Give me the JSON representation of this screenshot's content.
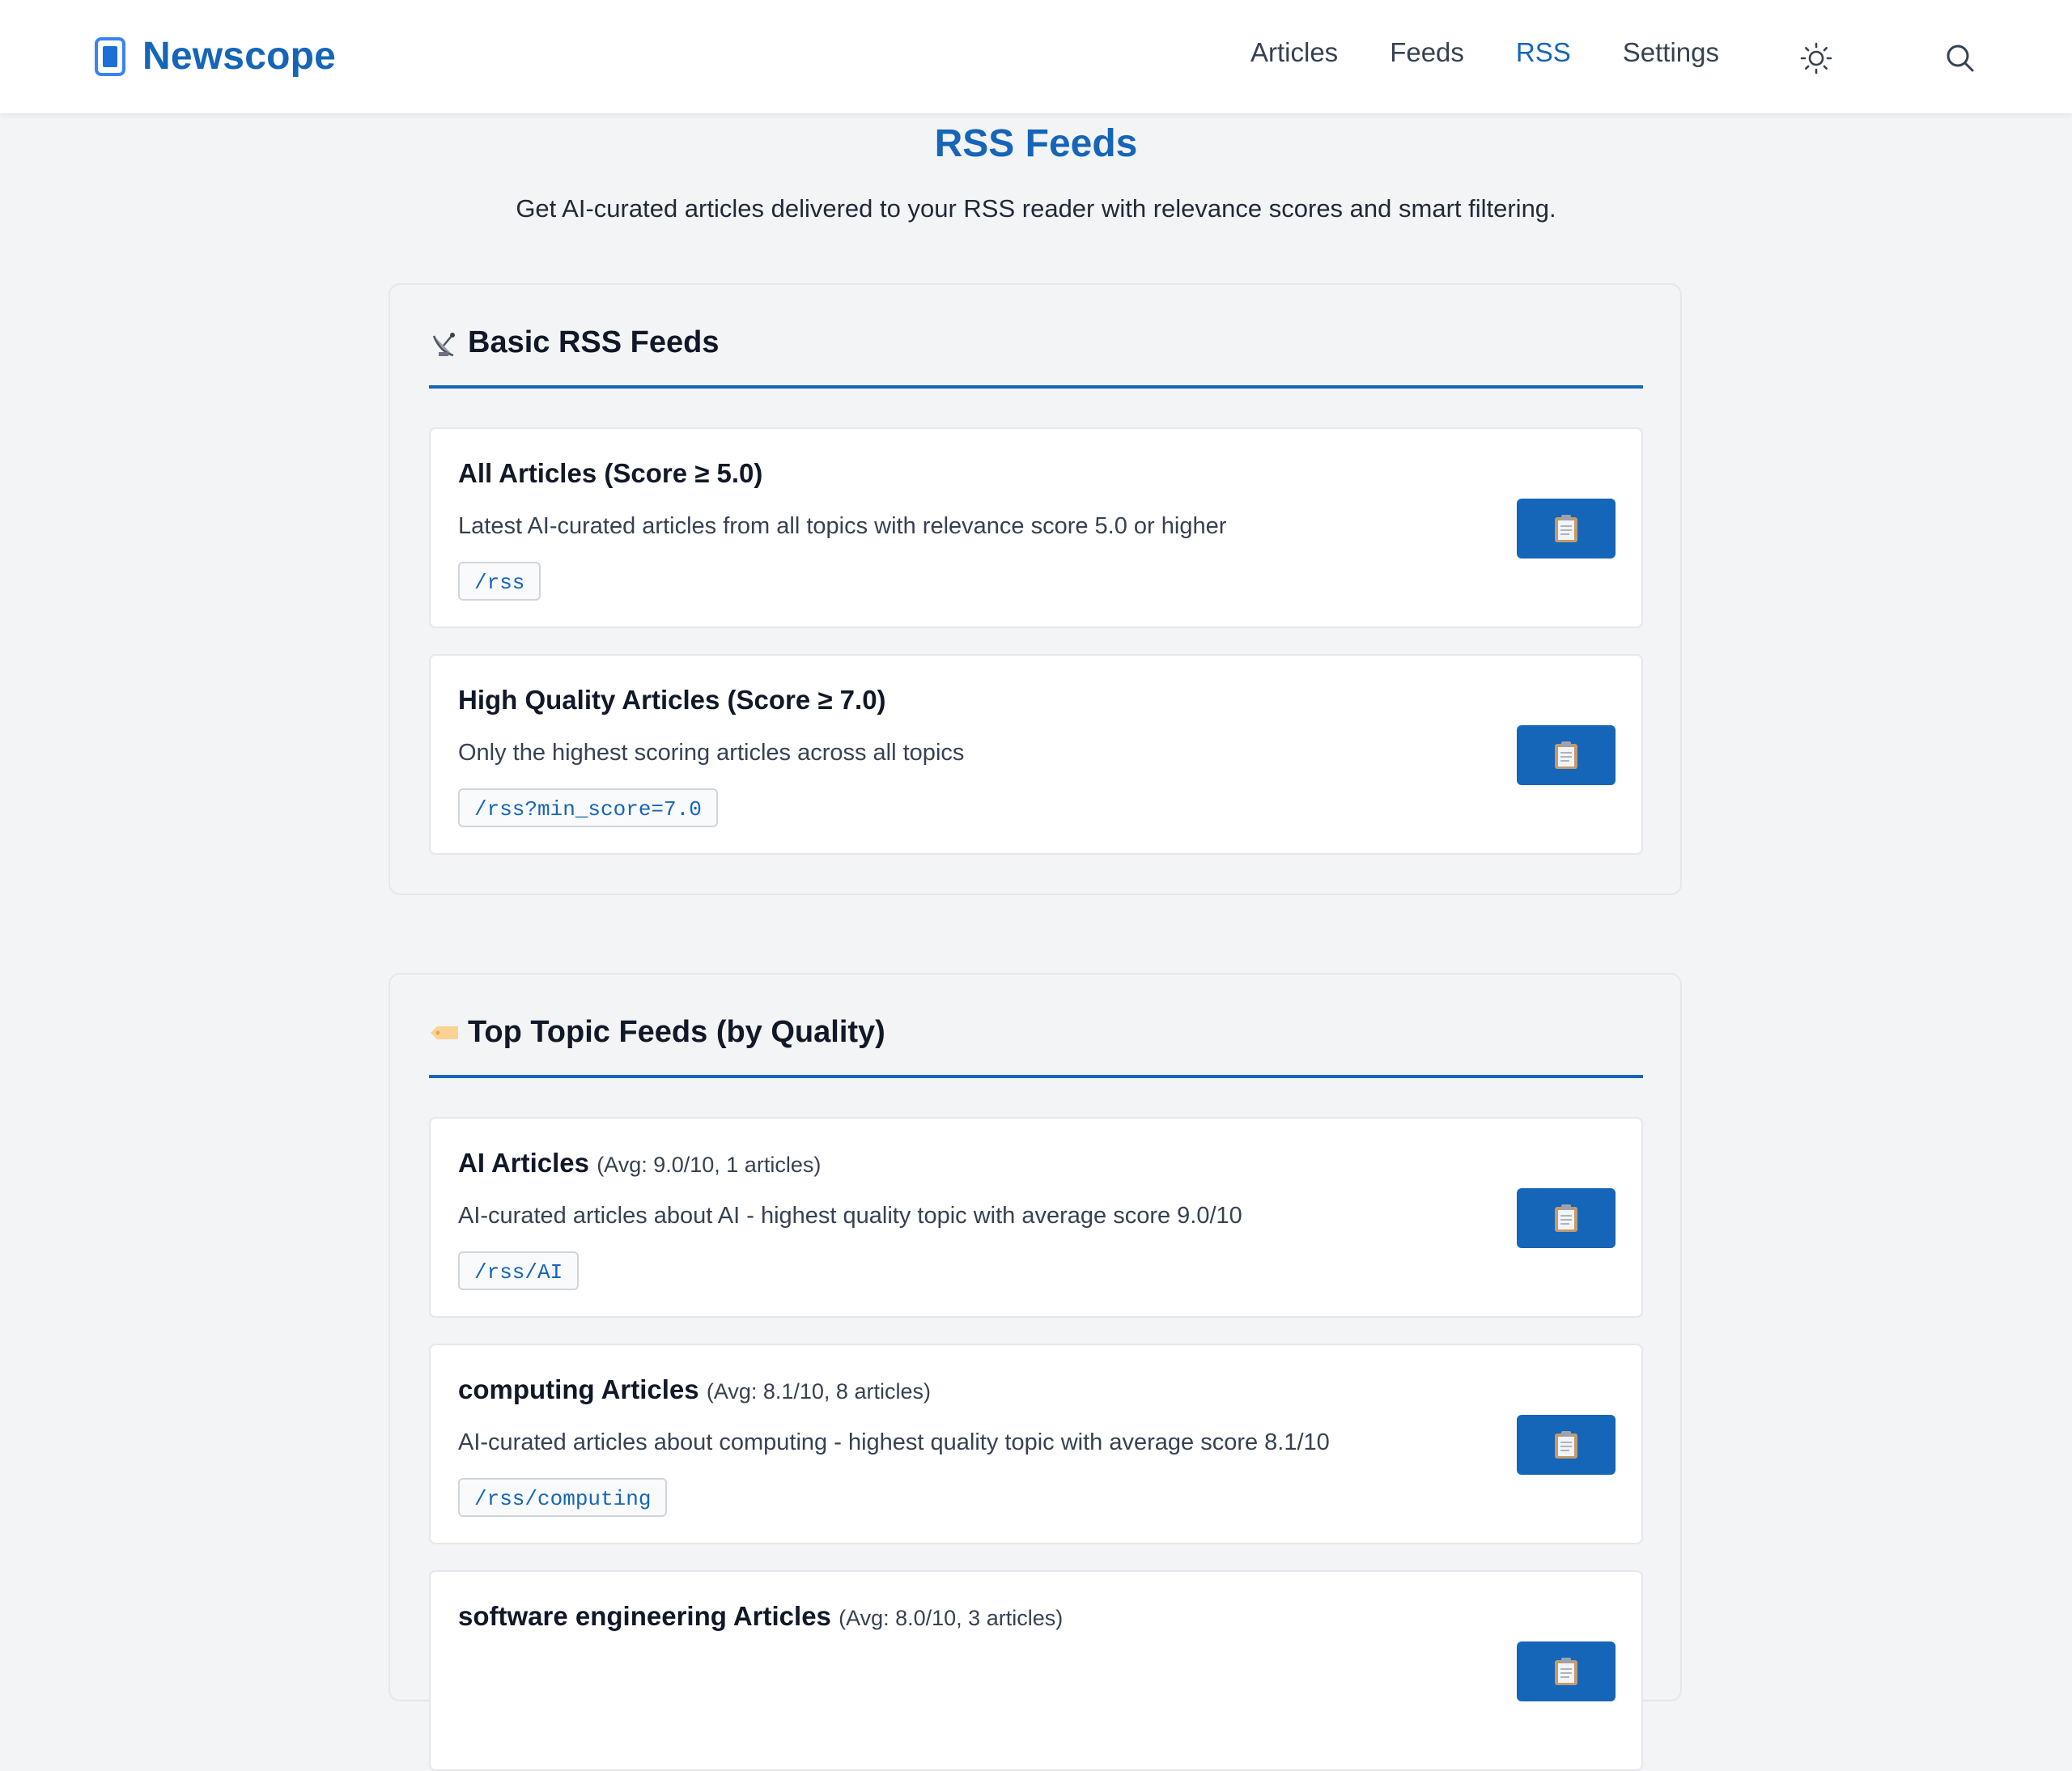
{
  "header": {
    "brand": "Newscope",
    "nav": [
      "Articles",
      "Feeds",
      "RSS",
      "Settings"
    ],
    "active_nav": "RSS",
    "icons": [
      "app-logo-icon",
      "sun-icon",
      "search-icon"
    ]
  },
  "page": {
    "title": "RSS Feeds",
    "subtitle": "Get AI-curated articles delivered to your RSS reader with relevance scores and smart filtering."
  },
  "sections": [
    {
      "title": "Basic RSS Feeds",
      "icon": "satellite-dish-icon",
      "feeds": [
        {
          "title": "All Articles (Score ≥ 5.0)",
          "description": "Latest AI-curated articles from all topics with relevance score 5.0 or higher",
          "path": "/rss"
        },
        {
          "title": "High Quality Articles (Score ≥ 7.0)",
          "description": "Only the highest scoring articles across all topics",
          "path": "/rss?min_score=7.0"
        }
      ]
    },
    {
      "title": "Top Topic Feeds (by Quality)",
      "icon": "tag-icon",
      "feeds": [
        {
          "title": "AI Articles",
          "meta": "(Avg: 9.0/10, 1 articles)",
          "description": "AI-curated articles about AI - highest quality topic with average score 9.0/10",
          "path": "/rss/AI"
        },
        {
          "title": "computing Articles",
          "meta": "(Avg: 8.1/10, 8 articles)",
          "description": "AI-curated articles about computing - highest quality topic with average score 8.1/10",
          "path": "/rss/computing"
        },
        {
          "title": "software engineering Articles",
          "meta": "(Avg: 8.0/10, 3 articles)"
        }
      ]
    }
  ],
  "copy_button_icon": "clipboard-icon",
  "colors": {
    "accent": "#1565b8",
    "background": "#f3f4f6",
    "card": "#ffffff"
  }
}
